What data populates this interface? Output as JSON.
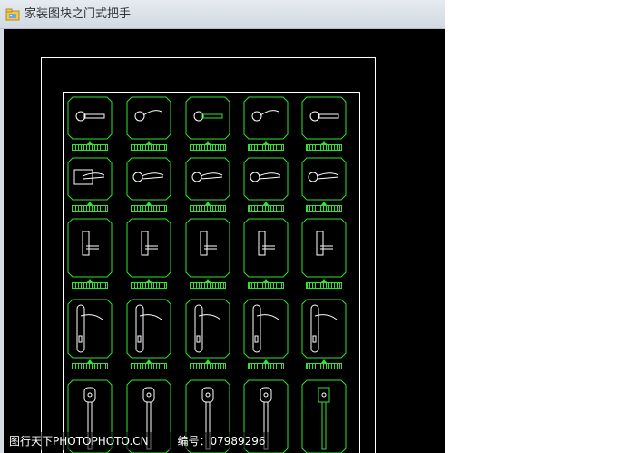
{
  "window": {
    "title": "家装图块之门式把手",
    "app_icon": "folder-image-icon"
  },
  "drawing": {
    "background": "#000000",
    "frame_color": "#ffffff",
    "tile_color": "#2fe32f",
    "handle_color": "#ffffff",
    "rows": [
      {
        "kind": "round-lever",
        "count": 5
      },
      {
        "kind": "square-lever",
        "count": 5
      },
      {
        "kind": "small-plate",
        "count": 5
      },
      {
        "kind": "long-plate",
        "count": 5
      },
      {
        "kind": "knob-plate",
        "count": 5
      }
    ]
  },
  "watermark": {
    "source": "图行天下PHOTOPHOTO.CN",
    "label": "编号：07989296"
  }
}
